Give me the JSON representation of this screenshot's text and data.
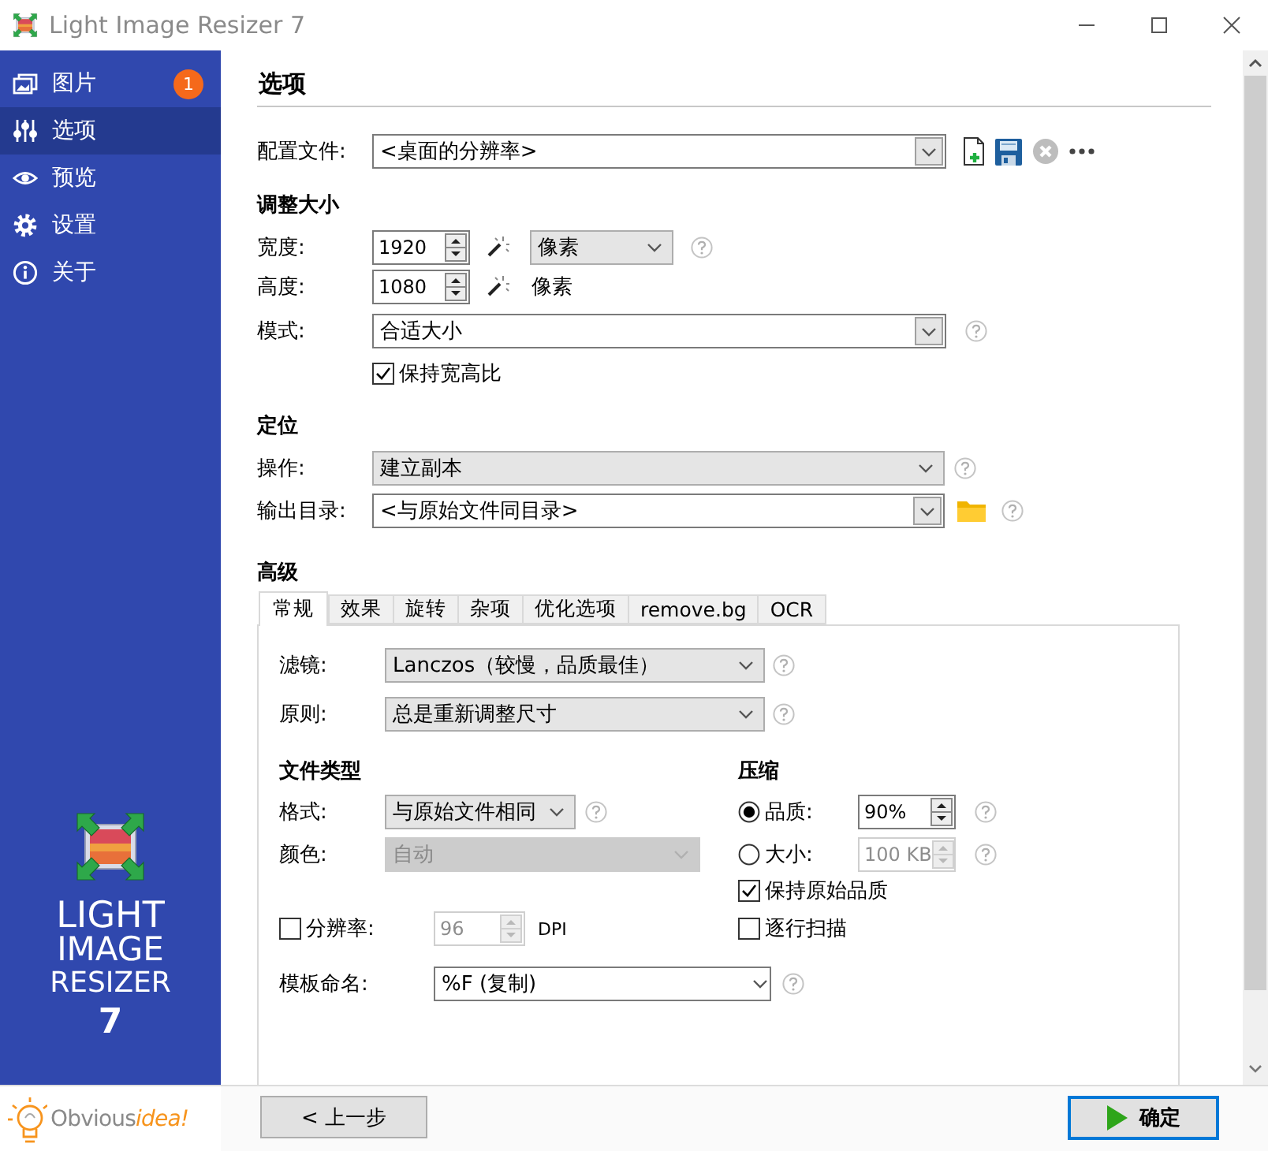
{
  "window": {
    "title": "Light Image Resizer 7"
  },
  "sidebar": {
    "items": [
      {
        "label": "图片",
        "badge": "1",
        "selected": false
      },
      {
        "label": "选项",
        "selected": true
      },
      {
        "label": "预览",
        "selected": false
      },
      {
        "label": "设置",
        "selected": false
      },
      {
        "label": "关于",
        "selected": false
      }
    ],
    "logo": {
      "lines": [
        "LIGHT",
        "IMAGE",
        "RESIZER"
      ],
      "version": "7"
    },
    "vendor": {
      "name": "Obvious",
      "accent": "idea!"
    }
  },
  "page": {
    "title": "选项"
  },
  "profile": {
    "label": "配置文件:",
    "value": "<桌面的分辨率>"
  },
  "resize": {
    "heading": "调整大小",
    "width": {
      "label": "宽度:",
      "value": "1920",
      "unit": "像素"
    },
    "height": {
      "label": "高度:",
      "value": "1080",
      "unit": "像素"
    },
    "mode": {
      "label": "模式:",
      "value": "合适大小"
    },
    "keep_ratio": {
      "label": "保持宽高比",
      "checked": true
    }
  },
  "position": {
    "heading": "定位",
    "action": {
      "label": "操作:",
      "value": "建立副本"
    },
    "output": {
      "label": "输出目录:",
      "value": "<与原始文件同目录>"
    }
  },
  "advanced": {
    "heading": "高级",
    "tabs": [
      {
        "label": "常规",
        "selected": true
      },
      {
        "label": "效果",
        "selected": false
      },
      {
        "label": "旋转",
        "selected": false
      },
      {
        "label": "杂项",
        "selected": false
      },
      {
        "label": "优化选项",
        "selected": false
      },
      {
        "label": "remove.bg",
        "selected": false
      },
      {
        "label": "OCR",
        "selected": false
      }
    ],
    "filter": {
      "label": "滤镜:",
      "value": "Lanczos（较慢，品质最佳）"
    },
    "rule": {
      "label": "原则:",
      "value": "总是重新调整尺寸"
    },
    "file_type": {
      "heading": "文件类型",
      "format": {
        "label": "格式:",
        "value": "与原始文件相同"
      },
      "color": {
        "label": "颜色:",
        "value": "自动",
        "disabled": true
      }
    },
    "compression": {
      "heading": "压缩",
      "quality": {
        "label": "品质:",
        "value": "90%",
        "selected": true
      },
      "size": {
        "label": "大小:",
        "value": "100 KB",
        "selected": false
      },
      "keep_quality": {
        "label": "保持原始品质",
        "checked": true
      },
      "progressive": {
        "label": "逐行扫描",
        "checked": false
      }
    },
    "resolution": {
      "label": "分辨率:",
      "checked": false,
      "value": "96",
      "unit": "DPI"
    },
    "template": {
      "label": "模板命名:",
      "value": "%F (复制)"
    }
  },
  "buttons": {
    "back": "< 上一步",
    "ok": "确定"
  }
}
